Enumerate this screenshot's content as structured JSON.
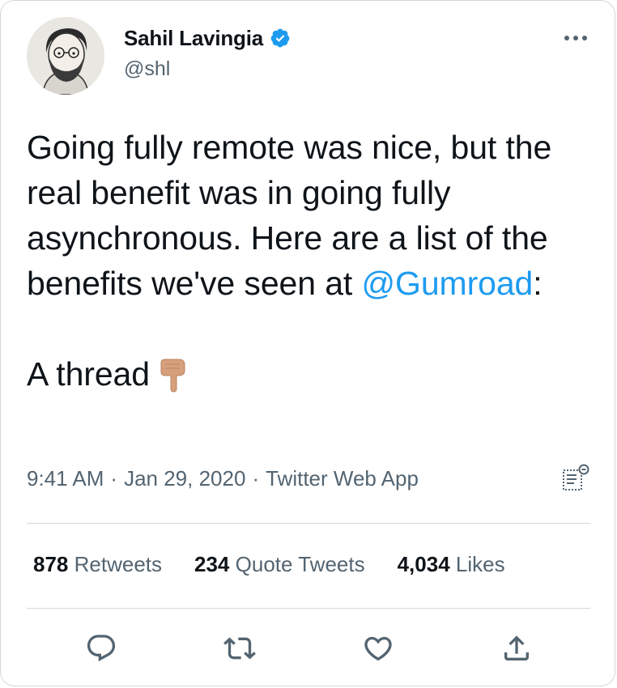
{
  "author": {
    "name": "Sahil Lavingia",
    "handle": "@shl",
    "verified": true
  },
  "tweet": {
    "line1": "Going fully remote was nice, but the real benefit was in going fully asynchronous. Here are a list of the benefits we've seen at ",
    "mention": "@Gumroad",
    "line1_end": ":",
    "line2": "A thread",
    "emoji": "backhand-index-pointing-down"
  },
  "meta": {
    "time": "9:41 AM",
    "separator": "·",
    "date": "Jan 29, 2020",
    "source": "Twitter Web App"
  },
  "stats": {
    "retweets_count": "878",
    "retweets_label": "Retweets",
    "quotes_count": "234",
    "quotes_label": "Quote Tweets",
    "likes_count": "4,034",
    "likes_label": "Likes"
  },
  "colors": {
    "accent": "#1d9bf0",
    "text": "#0f1419",
    "secondary": "#536471",
    "border": "#cfd9de"
  },
  "icons": {
    "more": "more-icon",
    "analytics": "analytics-icon",
    "reply": "reply-icon",
    "retweet": "retweet-icon",
    "like": "heart-icon",
    "share": "share-icon"
  }
}
